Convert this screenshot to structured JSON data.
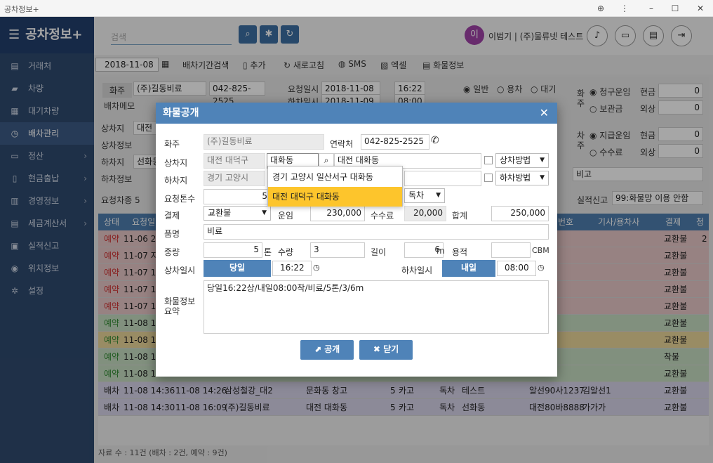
{
  "window": {
    "title": "공차정보+"
  },
  "brand": "공차정보+",
  "sidebar": {
    "items": [
      {
        "label": "거래처",
        "icon": "id-card-icon"
      },
      {
        "label": "차량",
        "icon": "truck-icon"
      },
      {
        "label": "대기차량",
        "icon": "calendar-icon"
      },
      {
        "label": "배차관리",
        "icon": "clock-icon"
      },
      {
        "label": "정산",
        "icon": "money-icon"
      },
      {
        "label": "현금출납",
        "icon": "document-icon"
      },
      {
        "label": "경영정보",
        "icon": "bar-chart-icon"
      },
      {
        "label": "세금계산서",
        "icon": "invoice-icon"
      },
      {
        "label": "실적신고",
        "icon": "report-icon"
      },
      {
        "label": "위치정보",
        "icon": "globe-icon"
      },
      {
        "label": "설정",
        "icon": "gears-icon"
      }
    ]
  },
  "header": {
    "search_placeholder": "검색",
    "avatar_initial": "이",
    "user_text": "이범기 | (주)물류넷 테스트"
  },
  "toolbar": {
    "date": "2018-11-08",
    "items": [
      "배차기간검색",
      "추가",
      "새로고침",
      "SMS",
      "엑셀",
      "화물정보"
    ]
  },
  "panel": {
    "shipper_label": "화주",
    "shipper": "(주)길동비료",
    "phone": "042-825-2525",
    "memo_label": "배차메모",
    "req_date_label": "요청일시",
    "req_date": "2018-11-08",
    "req_time": "16:22",
    "unload_date_label": "하차일시",
    "unload_date": "2018-11-09",
    "unload_time": "08:00",
    "radio_normal": "일반",
    "radio_yongcha": "용차",
    "radio_wait": "대기",
    "owner_col": "화주",
    "claim_fare": "청구운임",
    "cash": "현금",
    "zero": "0",
    "storage_fee": "보관금",
    "credit": "외상",
    "car_col": "차주",
    "pay_fare": "지급운임",
    "fee": "수수료",
    "load_place_label": "상차지",
    "load_info_label": "상차정보",
    "unload_place_label": "하차지",
    "unload_info_label": "하차정보",
    "req_count_label": "요청차종",
    "req_count": "5",
    "bigo": "비고",
    "report_label": "실적신고",
    "report_value": "99:화물망 이용 안함",
    "load_place_partial": "대전",
    "unload_place_partial": "선화동"
  },
  "grid": {
    "headers": [
      "상태",
      "요청일",
      "번호",
      "기사/용차사",
      "결제",
      "청구"
    ],
    "rows": [
      {
        "status": "예약",
        "req": "11-06 2",
        "pay": "교환불",
        "claim": "2",
        "color": "#e8c8c8",
        "status_color": "#d03030"
      },
      {
        "status": "예약",
        "req": "11-07 지",
        "pay": "교환불",
        "claim": "",
        "color": "#e8c8c8",
        "status_color": "#d03030"
      },
      {
        "status": "예약",
        "req": "11-07 1",
        "pay": "교환불",
        "claim": "",
        "color": "#e8c8c8",
        "status_color": "#d03030"
      },
      {
        "status": "예약",
        "req": "11-07 1",
        "pay": "교환불",
        "claim": "",
        "color": "#e8c8c8",
        "status_color": "#d03030"
      },
      {
        "status": "예약",
        "req": "11-07 1",
        "pay": "교환불",
        "claim": "",
        "color": "#e8c8c8",
        "status_color": "#d03030"
      },
      {
        "status": "예약",
        "req": "11-08 1",
        "pay": "교환불",
        "claim": "",
        "color": "#c6dec2",
        "status_color": "#2f8a2f"
      },
      {
        "status": "예약",
        "req": "11-08 1",
        "pay": "교환불",
        "claim": "",
        "color": "#ecd79a",
        "status_color": "#2f8a2f"
      },
      {
        "status": "예약",
        "req": "11-08 1",
        "pay": "착불",
        "claim": "",
        "color": "#c6dec2",
        "status_color": "#2f8a2f"
      },
      {
        "status": "예약",
        "req": "11-08 1",
        "pay": "교환불",
        "claim": "",
        "color": "#c6dec2",
        "status_color": "#2f8a2f"
      },
      {
        "status": "배차",
        "req": "11-08 14:36",
        "req2": "11-08 14:26",
        "shipper": "삼성철강_대2",
        "dest": "문화동 창고",
        "qty": "5",
        "item": "카고",
        "type": "독차",
        "loc": "테스트",
        "car": "알선90사1237",
        "driver": "김알선1",
        "pay": "교환불",
        "claim": "",
        "color": "#d8d4ea",
        "status_color": "#222"
      },
      {
        "status": "배차",
        "req": "11-08 14:30",
        "req2": "11-08 16:09",
        "shipper": "(주)길동비료",
        "dest": "대전 대화동",
        "qty": "5",
        "item": "카고",
        "type": "독차",
        "loc": "선화동",
        "car": "대전80바8888",
        "driver": "가가가",
        "pay": "교환불",
        "claim": "",
        "color": "#d8d4ea",
        "status_color": "#222"
      }
    ]
  },
  "status_text": "자료 수 : 11건 (배차 : 2건, 예약 : 9건)",
  "modal": {
    "title": "화물공개",
    "shipper_label": "화주",
    "shipper": "(주)길동비료",
    "contact_label": "연락처",
    "contact": "042-825-2525",
    "load_label": "상차지",
    "load_region": "대전 대덕구",
    "load_query": "대화동",
    "load_dong": "대전 대화동",
    "load_method": "상차방법",
    "unload_label": "하차지",
    "unload_region": "경기 고양시",
    "unload_method": "하차방법",
    "tonnage_label": "요청톤수",
    "tonnage": "5",
    "car_kind": "독차",
    "pay_label": "결제",
    "pay": "교환불",
    "fare_label": "운임",
    "fare": "230,000",
    "fee_label": "수수료",
    "fee": "20,000",
    "total_label": "합계",
    "total": "250,000",
    "item_label": "품명",
    "item": "비료",
    "weight_label": "중량",
    "weight": "5",
    "weight_unit": "톤",
    "qty_label": "수량",
    "qty": "3",
    "length_label": "길이",
    "length": "6",
    "length_unit": "m",
    "volume_label": "용적",
    "volume_unit": "CBM",
    "load_time_label": "상차일시",
    "load_day": "당일",
    "load_time": "16:22",
    "unload_time_label": "하차일시",
    "unload_day": "내일",
    "unload_time": "08:00",
    "summary_label": "화물정보\n요약",
    "summary": "당일16:22상/내일08:00착/비료/5톤/3/6m",
    "open_button": "공개",
    "close_button": "닫기",
    "dropdown": [
      "경기 고양시 일산서구 대화동",
      "대전 대덕구 대화동"
    ]
  }
}
